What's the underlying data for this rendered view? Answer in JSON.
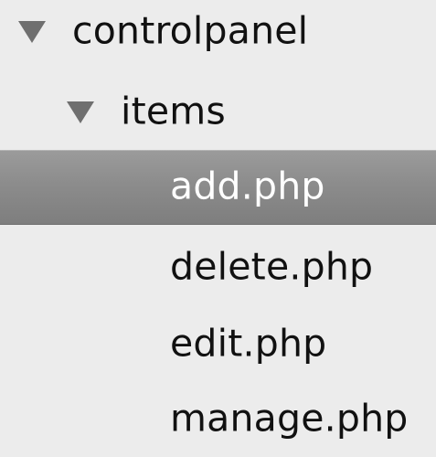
{
  "tree": {
    "items": [
      {
        "label": "controlpanel",
        "icon": "disclosure-triangle-expanded-icon",
        "expanded": true,
        "selected": false
      },
      {
        "label": "items",
        "icon": "disclosure-triangle-expanded-icon",
        "expanded": true,
        "selected": false
      },
      {
        "label": "add.php",
        "selected": true
      },
      {
        "label": "delete.php",
        "selected": false
      },
      {
        "label": "edit.php",
        "selected": false
      },
      {
        "label": "manage.php",
        "selected": false
      }
    ]
  },
  "colors": {
    "background": "#ececec",
    "selection": "#8c8c8c",
    "text": "#111111",
    "selected_text": "#ffffff",
    "triangle": "#6f6f6f"
  }
}
